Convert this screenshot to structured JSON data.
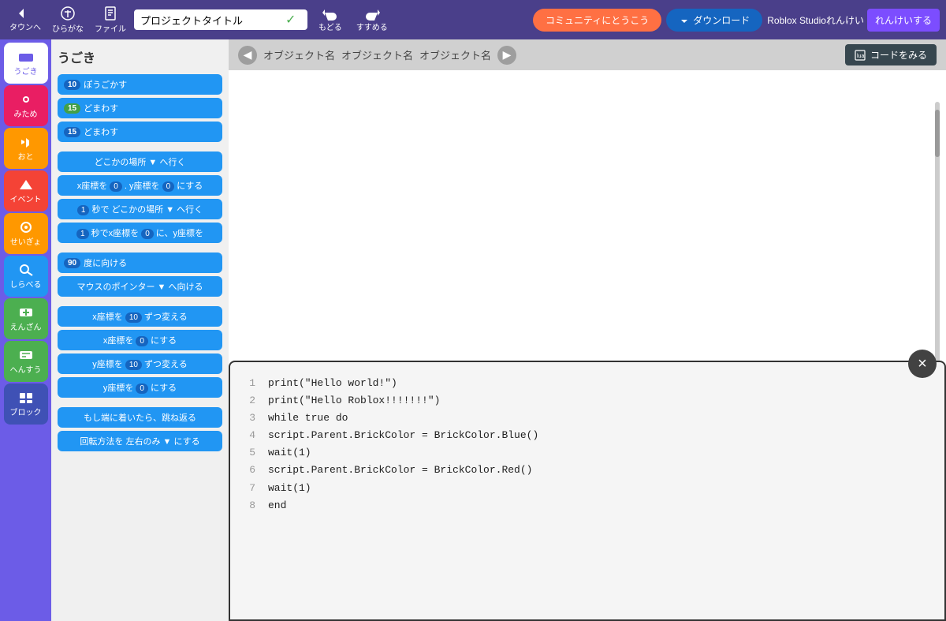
{
  "topbar": {
    "back_label": "タウンへ",
    "hiragana_label": "ひらがな",
    "file_label": "ファイル",
    "project_title": "プロジェクトタイトル",
    "back_arrow": "もどる",
    "forward_arrow": "すすめる",
    "community_btn": "コミュニティにとうこう",
    "download_btn": "ダウンロード",
    "roblox_link": "Roblox Studioれんけい",
    "renkei_btn": "れんけいする"
  },
  "sidebar": {
    "items": [
      {
        "id": "ugoki",
        "label": "うごき",
        "active": true
      },
      {
        "id": "mitame",
        "label": "みため"
      },
      {
        "id": "oto",
        "label": "おと"
      },
      {
        "id": "event",
        "label": "イベント"
      },
      {
        "id": "seigyo",
        "label": "せいぎょ"
      },
      {
        "id": "shiraberu",
        "label": "しらべる"
      },
      {
        "id": "enzai",
        "label": "えんざん"
      },
      {
        "id": "hentai",
        "label": "へんすう"
      },
      {
        "id": "block",
        "label": "ブロック"
      }
    ]
  },
  "panel": {
    "title": "うごき",
    "blocks": [
      {
        "id": "b1",
        "badge": "10",
        "badge_color": "blue",
        "label": "ぽうごかす"
      },
      {
        "id": "b2",
        "badge": "15",
        "badge_color": "green",
        "label": "どまわす"
      },
      {
        "id": "b3",
        "badge": "15",
        "badge_color": "blue",
        "label": "どまわす"
      },
      {
        "id": "b4",
        "label": "どこかの場所 ▼ へ行く",
        "wide": true
      },
      {
        "id": "b5",
        "label": "x座標を 0 . y座標を 0 にする",
        "wide": true
      },
      {
        "id": "b6",
        "label": "1 秒で どこかの場所 ▼ へ行く",
        "wide": true
      },
      {
        "id": "b7",
        "label": "1 秒でx座標を 0 に、y座標を",
        "wide": true
      },
      {
        "id": "b8",
        "badge": "90",
        "badge_color": "blue",
        "label": "度に向ける"
      },
      {
        "id": "b9",
        "label": "マウスのポインター ▼ へ向ける",
        "wide": true
      },
      {
        "id": "b10",
        "label": "x座標を 10 ずつ変える",
        "wide": true
      },
      {
        "id": "b11",
        "label": "x座標を 0 にする",
        "wide": true
      },
      {
        "id": "b12",
        "label": "y座標を 10 ずつ変える",
        "wide": true
      },
      {
        "id": "b13",
        "label": "y座標を 0 にする",
        "wide": true
      },
      {
        "id": "b14",
        "label": "もし端に着いたら、跳ね返る",
        "wide": true
      },
      {
        "id": "b15",
        "label": "回転方法を 左右のみ ▼ にする",
        "wide": true
      }
    ]
  },
  "canvas": {
    "nav_left": "◀",
    "nav_right": "▶",
    "object1": "オブジェクト名",
    "object2": "オブジェクト名",
    "object3": "オブジェクト名",
    "code_btn_label": "コードをみる"
  },
  "code_panel": {
    "close_btn": "×",
    "lines": [
      {
        "num": "1",
        "code": "print(\"Hello world!\")"
      },
      {
        "num": "2",
        "code": "print(\"Hello Roblox!!!!!!!\")"
      },
      {
        "num": "3",
        "code": "while true do"
      },
      {
        "num": "4",
        "code": "    script.Parent.BrickColor = BrickColor.Blue()"
      },
      {
        "num": "5",
        "code": "    wait(1)"
      },
      {
        "num": "6",
        "code": "    script.Parent.BrickColor = BrickColor.Red()"
      },
      {
        "num": "7",
        "code": "    wait(1)"
      },
      {
        "num": "8",
        "code": "end"
      }
    ]
  }
}
